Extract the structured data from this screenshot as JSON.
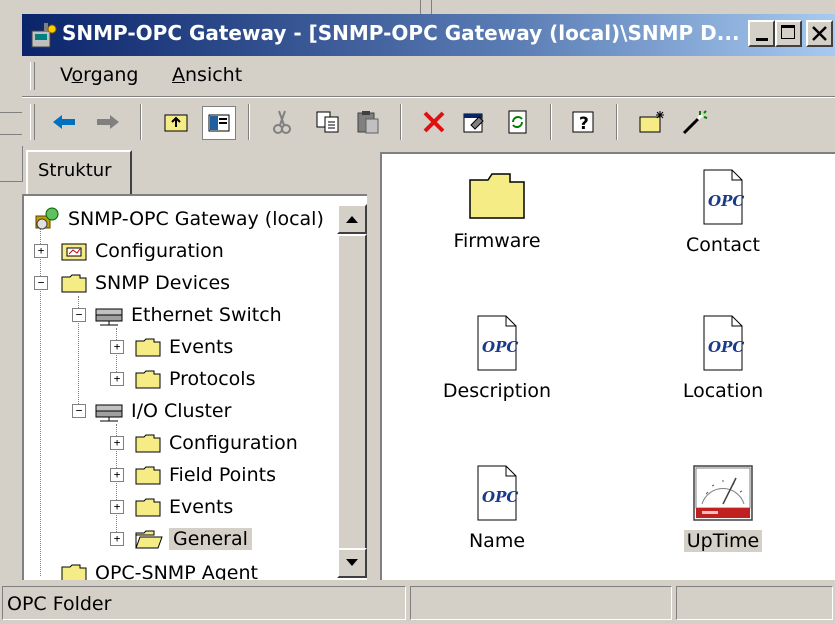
{
  "window": {
    "title": "SNMP-OPC Gateway - [SNMP-OPC Gateway (local)\\SNMP D...",
    "minimize_glyph": "_",
    "maximize_glyph": "□",
    "close_glyph": "×"
  },
  "menu": {
    "items": [
      {
        "label": "Vorgang",
        "accel": "o"
      },
      {
        "label": "Ansicht",
        "accel": "A"
      }
    ]
  },
  "toolbar": {
    "icons": [
      "back-icon",
      "forward-icon",
      "up-folder-icon",
      "show-tree-icon",
      "cut-icon",
      "copy-icon",
      "paste-icon",
      "delete-icon",
      "properties-icon",
      "refresh-icon",
      "help-icon",
      "new-folder-icon",
      "wizard-icon"
    ]
  },
  "tabs": {
    "structure": "Struktur"
  },
  "tree": {
    "root": "SNMP-OPC Gateway (local)",
    "configuration": "Configuration",
    "snmp_devices": "SNMP Devices",
    "ethernet_switch": "Ethernet Switch",
    "es_events": "Events",
    "es_protocols": "Protocols",
    "io_cluster": "I/O Cluster",
    "io_configuration": "Configuration",
    "io_field_points": "Field Points",
    "io_events": "Events",
    "io_general": "General",
    "opc_snmp_agent": "OPC-SNMP Agent"
  },
  "list": {
    "items": [
      {
        "label": "Firmware",
        "icon": "folder"
      },
      {
        "label": "Contact",
        "icon": "opc-document"
      },
      {
        "label": "Description",
        "icon": "opc-document"
      },
      {
        "label": "Location",
        "icon": "opc-document"
      },
      {
        "label": "Name",
        "icon": "opc-document"
      },
      {
        "label": "UpTime",
        "icon": "gauge"
      }
    ],
    "opc_logo_text": "OPC"
  },
  "status": {
    "panel1": "OPC Folder",
    "panel2": "",
    "panel3": ""
  },
  "colors": {
    "title_gradient_start": "#0a246a",
    "title_gradient_end": "#a6caf0",
    "folder_yellow": "#f5ec86",
    "delete_red": "#e01010"
  }
}
